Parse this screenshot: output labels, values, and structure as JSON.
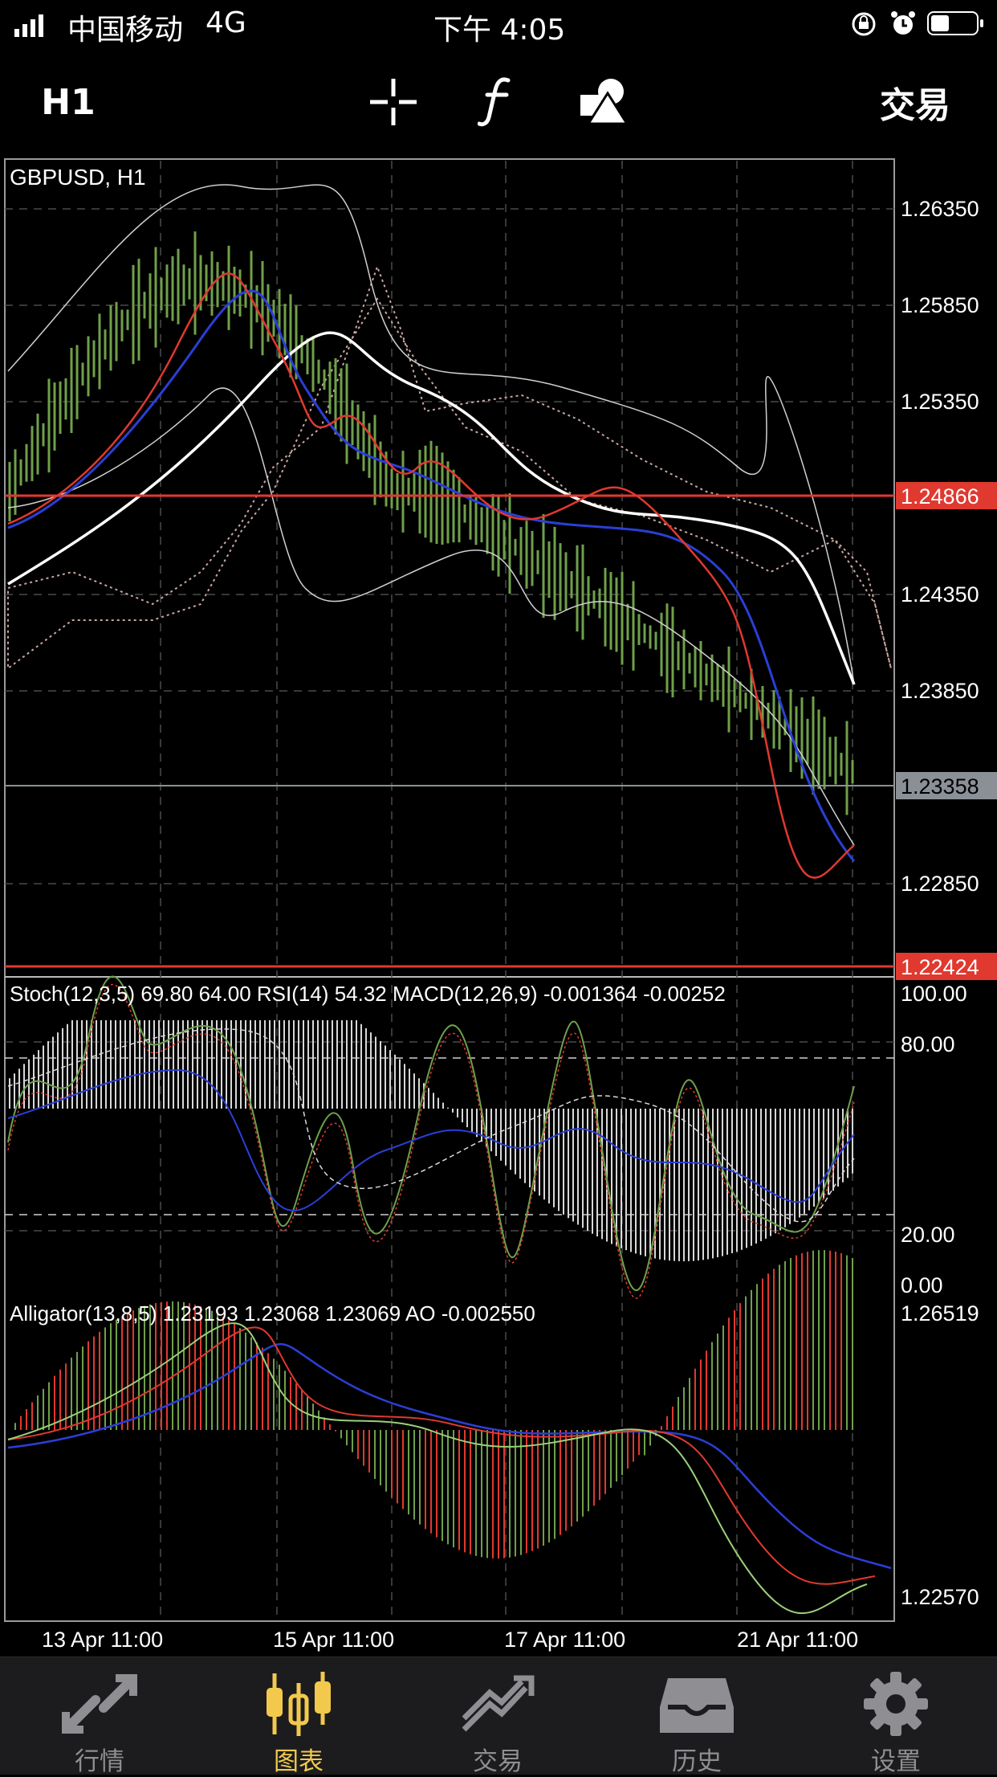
{
  "status_bar": {
    "carrier": "中国移动",
    "network": "4G",
    "time": "下午 4:05"
  },
  "toolbar": {
    "timeframe": "H1",
    "trade_label": "交易",
    "icons": [
      "crosshair-icon",
      "function-icon",
      "objects-icon"
    ]
  },
  "chart": {
    "symbol_label": "GBPUSD, H1",
    "price_levels": [
      "1.26350",
      "1.25850",
      "1.25350",
      "1.24350",
      "1.23850",
      "1.22850"
    ],
    "highlight_levels": [
      {
        "label": "1.24866",
        "color": "#e0392f"
      },
      {
        "label": "1.23358",
        "color": "#8a9096"
      },
      {
        "label": "1.22424",
        "color": "#e0392f"
      }
    ],
    "oscillator_header": "Stoch(12,3,5) 69.80 64.00 RSI(14) 54.32 MACD(12,26,9) -0.001364 -0.00252",
    "oscillator_levels": [
      "100.00",
      "80.00",
      "20.00",
      "0.00"
    ],
    "alligator_header": "Alligator(13,8,5) 1.23193 1.23068 1.23069 AO -0.002550",
    "alligator_levels": [
      "1.26519",
      "1.22570"
    ],
    "x_labels": [
      "13 Apr 11:00",
      "15 Apr 11:00",
      "17 Apr 11:00",
      "21 Apr 11:00"
    ],
    "colors": {
      "grid": "#555555",
      "candle_green": "#6fa04a",
      "ma_red": "#e0392f",
      "ma_blue": "#2a3fd6",
      "ma_white": "#ffffff",
      "cloud": "#c9a6a0"
    }
  },
  "tabs": [
    {
      "label": "行情",
      "icon": "quotes-icon",
      "active": false
    },
    {
      "label": "图表",
      "icon": "chart-icon",
      "active": true
    },
    {
      "label": "交易",
      "icon": "trade-icon",
      "active": false
    },
    {
      "label": "历史",
      "icon": "history-icon",
      "active": false
    },
    {
      "label": "设置",
      "icon": "settings-icon",
      "active": false
    }
  ]
}
